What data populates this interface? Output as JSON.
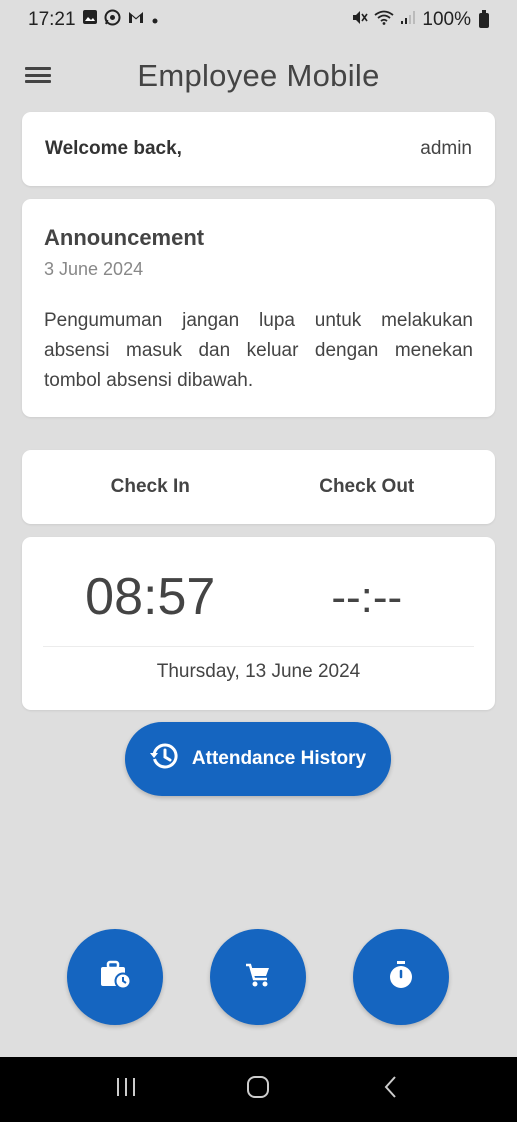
{
  "status_bar": {
    "time": "17:21",
    "notification_icons": [
      "gallery-icon",
      "whatsapp-icon",
      "gmail-icon",
      "dot-icon"
    ],
    "right_icons": [
      "mute-icon",
      "wifi-icon",
      "signal-icon"
    ],
    "battery": "100%"
  },
  "app_bar": {
    "title": "Employee Mobile"
  },
  "welcome": {
    "label": "Welcome back,",
    "user": "admin"
  },
  "announcement": {
    "title": "Announcement",
    "date": "3 June 2024",
    "body": "Pengumuman jangan lupa untuk melakukan absensi masuk dan keluar dengan menekan tombol absensi dibawah."
  },
  "attendance": {
    "check_in_label": "Check In",
    "check_out_label": "Check Out",
    "check_in_time": "08:57",
    "check_out_time": "--:--",
    "date": "Thursday, 13 June 2024"
  },
  "history_button": {
    "label": "Attendance History",
    "icon": "history-icon"
  },
  "fabs": [
    {
      "icon": "leave-briefcase-icon"
    },
    {
      "icon": "cart-icon"
    },
    {
      "icon": "stopwatch-icon"
    }
  ],
  "colors": {
    "primary": "#1565c0",
    "background": "#dedede",
    "card": "#ffffff"
  }
}
